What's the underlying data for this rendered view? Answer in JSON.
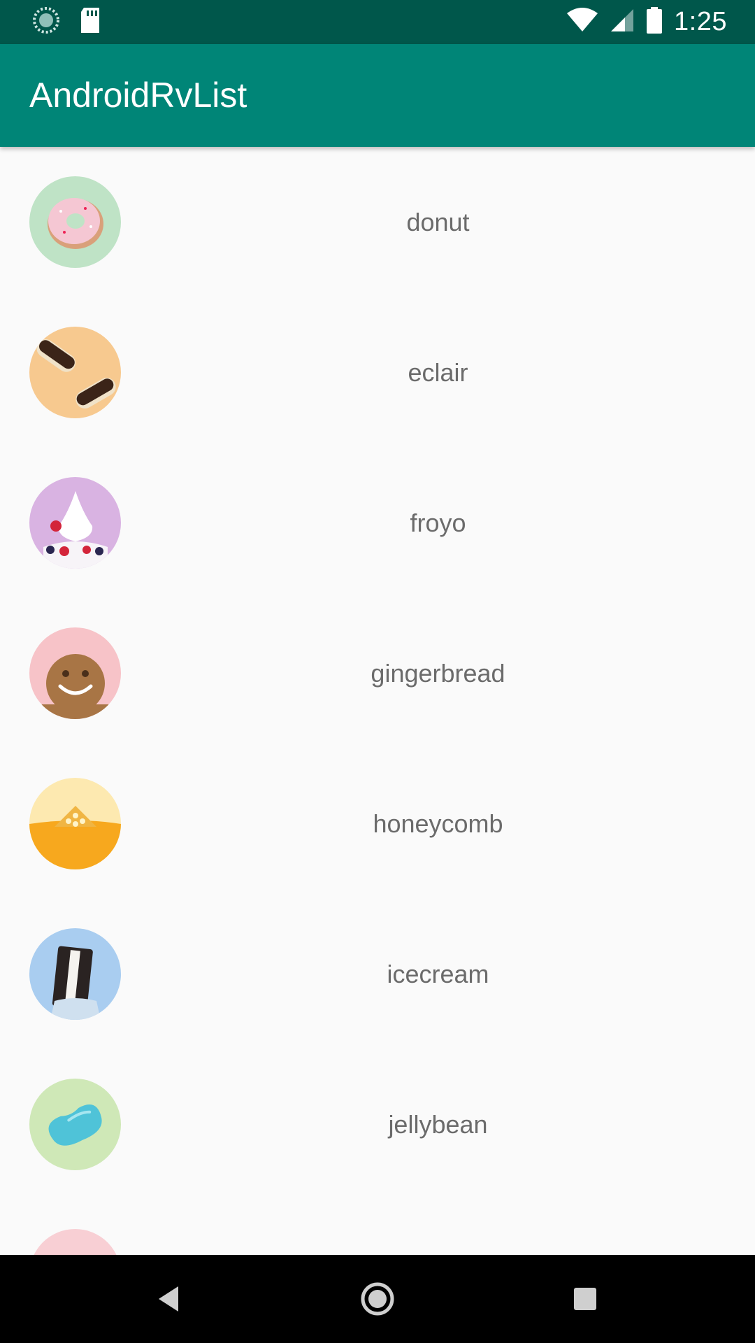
{
  "status_bar": {
    "time": "1:25",
    "background": "#00574b",
    "icons": [
      "sync-icon",
      "sd-card-icon",
      "wifi-icon",
      "signal-icon",
      "battery-icon"
    ]
  },
  "app_bar": {
    "title": "AndroidRvList",
    "background": "#008577"
  },
  "list": {
    "items": [
      {
        "label": "donut",
        "icon": "donut-icon",
        "bg": "#bfe3c6"
      },
      {
        "label": "eclair",
        "icon": "eclair-icon",
        "bg": "#f7c98f"
      },
      {
        "label": "froyo",
        "icon": "froyo-icon",
        "bg": "#d9b3e2"
      },
      {
        "label": "gingerbread",
        "icon": "gingerbread-icon",
        "bg": "#f7c3c8"
      },
      {
        "label": "honeycomb",
        "icon": "honeycomb-icon",
        "bg": "#fde9b0"
      },
      {
        "label": "icecream",
        "icon": "icecream-sandwich-icon",
        "bg": "#a9cdf0"
      },
      {
        "label": "jellybean",
        "icon": "jellybean-icon",
        "bg": "#cfe8b7"
      },
      {
        "label": "",
        "icon": "kitkat-icon",
        "bg": "#f8cfd4"
      }
    ]
  },
  "nav_bar": {
    "buttons": [
      "back-icon",
      "home-icon",
      "recents-icon"
    ]
  }
}
